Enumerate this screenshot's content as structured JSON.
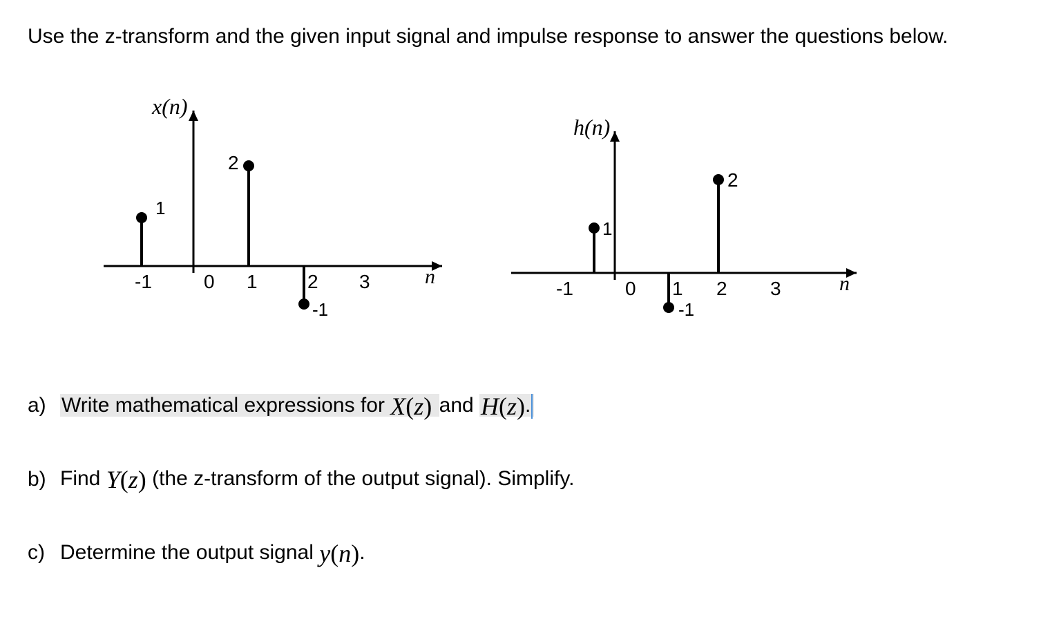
{
  "intro": "Use the z-transform and the given input signal and impulse response to answer the questions below.",
  "plot_x": {
    "label": "x(n)",
    "axis_label": "n",
    "ticks": [
      "-1",
      "0",
      "1",
      "2",
      "3"
    ],
    "stems": [
      {
        "n": -1,
        "value": 1,
        "value_label": "1"
      },
      {
        "n": 1,
        "value": 2,
        "value_label": "2"
      },
      {
        "n": 2,
        "value": -1,
        "value_label": "-1"
      }
    ]
  },
  "plot_h": {
    "label": "h(n)",
    "axis_label": "n",
    "ticks": [
      "-1",
      "0",
      "1",
      "2",
      "3"
    ],
    "stems": [
      {
        "n": -1,
        "value": 1,
        "value_label": "1"
      },
      {
        "n": 1,
        "value": -1,
        "value_label": "-1"
      },
      {
        "n": 2,
        "value": 2,
        "value_label": "2"
      }
    ]
  },
  "questions": {
    "a": {
      "label": "a)",
      "text_before": "Write mathematical expressions for ",
      "math1": "X(z)",
      "text_middle": " and ",
      "math2": "H(z)",
      "text_after": "."
    },
    "b": {
      "label": "b)",
      "text_before": "Find ",
      "math1": "Y(z)",
      "text_after": " (the z-transform of the output signal).  Simplify."
    },
    "c": {
      "label": "c)",
      "text_before": "Determine the output signal ",
      "math1": "y(n)",
      "text_after": "."
    }
  },
  "chart_data": [
    {
      "type": "stem",
      "title": "x(n)",
      "xlabel": "n",
      "x": [
        -1,
        1,
        2
      ],
      "values": [
        1,
        2,
        -1
      ],
      "xlim": [
        -1.5,
        4
      ],
      "ylim": [
        -1.5,
        2.5
      ]
    },
    {
      "type": "stem",
      "title": "h(n)",
      "xlabel": "n",
      "x": [
        -1,
        1,
        2
      ],
      "values": [
        1,
        -1,
        2
      ],
      "xlim": [
        -1.5,
        4
      ],
      "ylim": [
        -1.5,
        2.5
      ]
    }
  ]
}
